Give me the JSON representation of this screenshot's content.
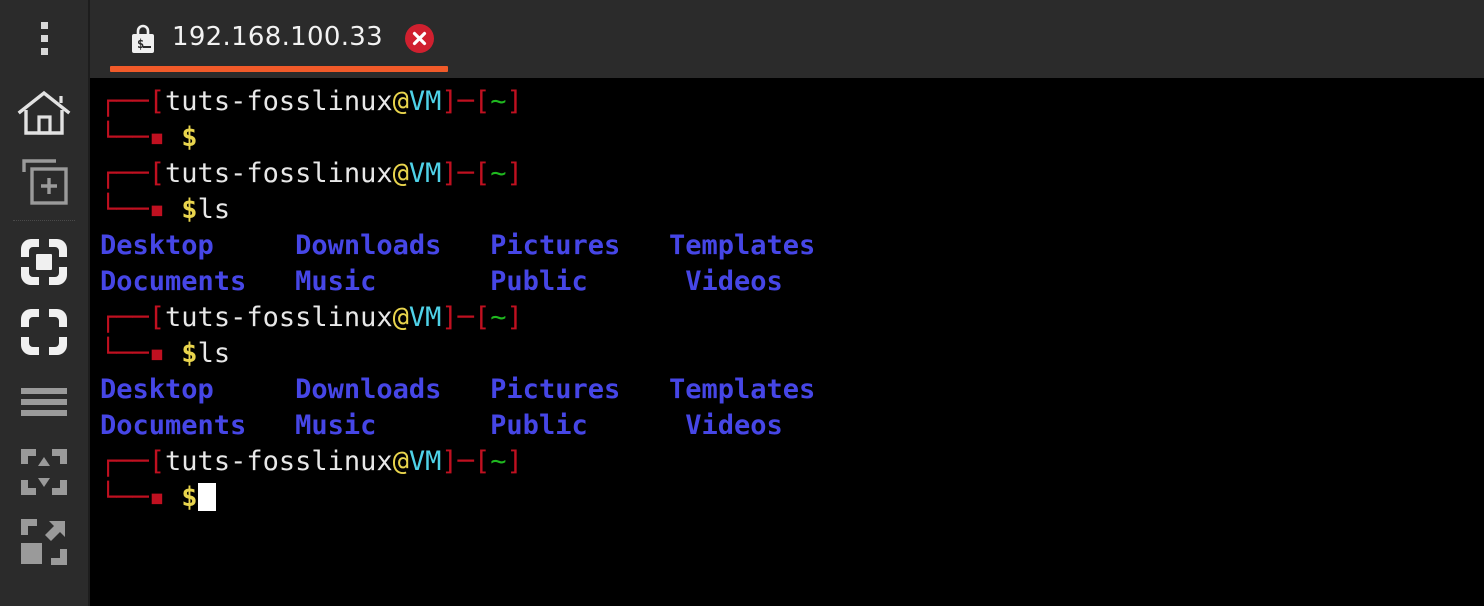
{
  "sidebar": {
    "items": [
      {
        "name": "overflow-menu",
        "label": "More options",
        "icon": "kebab-menu-icon"
      },
      {
        "name": "home",
        "label": "Home",
        "icon": "home-icon"
      },
      {
        "name": "new-session",
        "label": "New session",
        "icon": "new-tab-icon"
      },
      {
        "name": "fit-to-screen",
        "label": "Fit to screen",
        "icon": "fit-screen-icon"
      },
      {
        "name": "fullscreen",
        "label": "Fullscreen",
        "icon": "fullscreen-icon"
      },
      {
        "name": "menu",
        "label": "Menu",
        "icon": "hamburger-icon"
      },
      {
        "name": "scale-vertical",
        "label": "Scale vertically",
        "icon": "scale-vertical-icon"
      },
      {
        "name": "expand",
        "label": "Expand",
        "icon": "expand-arrow-icon"
      }
    ]
  },
  "tabbar": {
    "tab": {
      "title": "192.168.100.33",
      "icon": "ssh-lock-terminal-icon",
      "close_icon": "close-icon",
      "active": true,
      "accent_color": "#f15a29"
    }
  },
  "terminal": {
    "colors": {
      "background": "#000000",
      "frame": "#c01020",
      "user": "#e8e8e8",
      "at": "#e8d44d",
      "host": "#4fd2e8",
      "path": "#1fb81f",
      "prompt": "#e8d44d",
      "directory": "#4646e6"
    },
    "prompt": {
      "top_left": "┌──",
      "bottom_left": "└──",
      "bracket_open": "[",
      "bracket_close": "]",
      "user": "tuts-fosslinux",
      "at": "@",
      "host": "VM",
      "dash": "─",
      "path": "~",
      "symbol": "$"
    },
    "listing_columns": [
      [
        "Desktop",
        "Documents"
      ],
      [
        "Downloads",
        "Music"
      ],
      [
        "Pictures",
        "Public"
      ],
      [
        "Templates",
        "Videos"
      ]
    ],
    "blocks": [
      {
        "command": ""
      },
      {
        "command": "ls"
      },
      {
        "command": "ls"
      },
      {
        "command": ""
      }
    ]
  }
}
